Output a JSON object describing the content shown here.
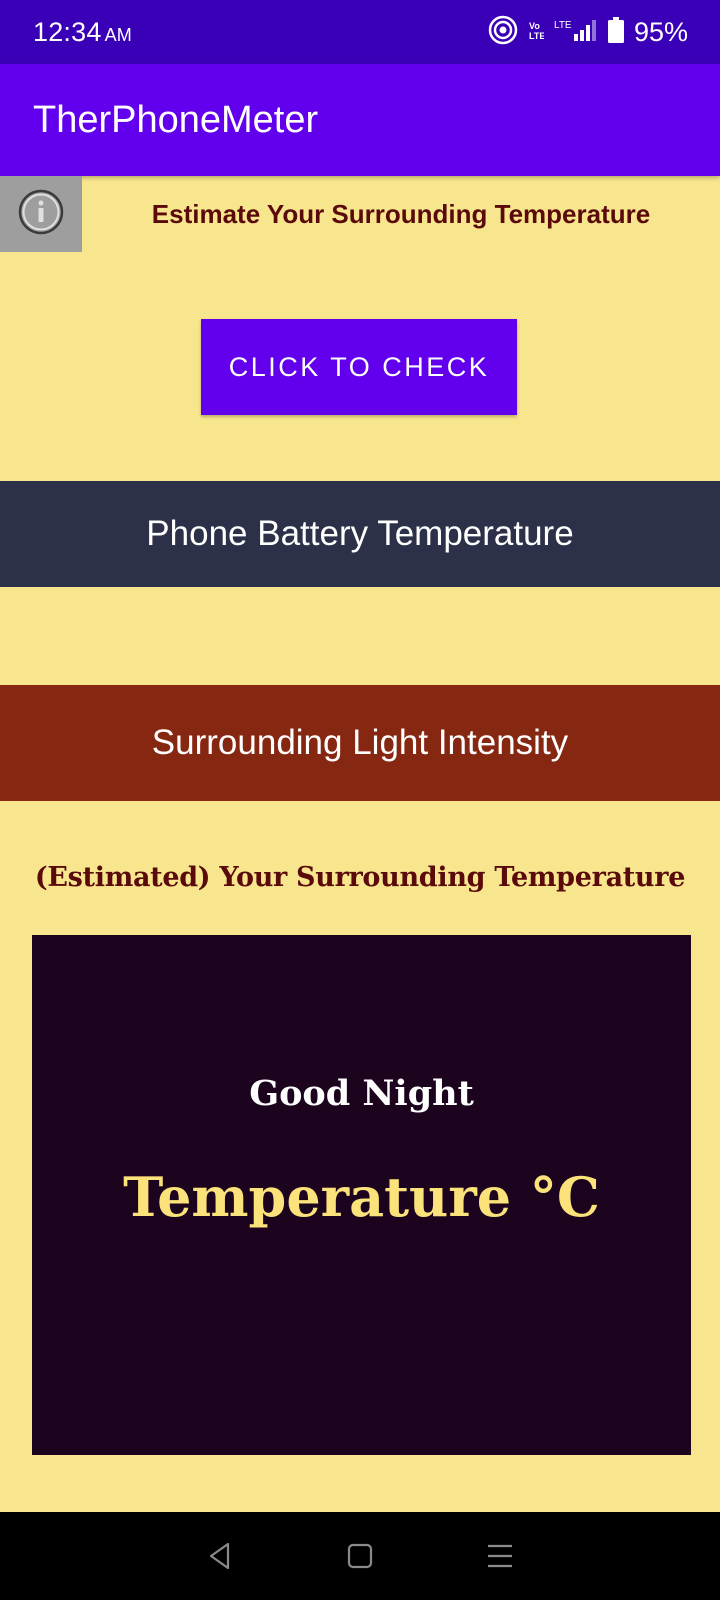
{
  "status_bar": {
    "time": "12:34",
    "ampm": "AM",
    "battery": "95%",
    "network_label": "LTE"
  },
  "app_bar": {
    "title": "TherPhoneMeter"
  },
  "header": {
    "subtitle": "Estimate Your Surrounding Temperature"
  },
  "check_button": {
    "label": "CLICK TO CHECK"
  },
  "battery_section": {
    "label": "Phone Battery Temperature"
  },
  "light_section": {
    "label": "Surrounding Light Intensity"
  },
  "estimated_section": {
    "label": "(Estimated) Your Surrounding Temperature"
  },
  "display": {
    "greeting": "Good Night",
    "temperature": "Temperature °C"
  },
  "colors": {
    "background": "#F8E68F",
    "status_bar": "#3A00B8",
    "primary": "#6200EE",
    "battery_band": "#2C3048",
    "light_band": "#862711",
    "display_bg": "#1C041E",
    "temp_text": "#FBE27A",
    "heading_text": "#5A0A0A"
  },
  "icons": [
    "hotspot-icon",
    "volte-icon",
    "signal-icon",
    "battery-icon",
    "info-icon",
    "back-icon",
    "home-icon",
    "menu-icon"
  ]
}
